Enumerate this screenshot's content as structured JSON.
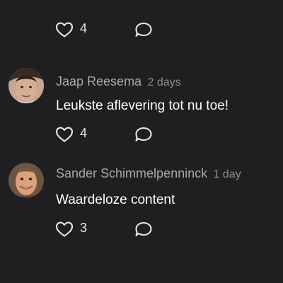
{
  "top_actions": {
    "like_count": "4"
  },
  "comments": [
    {
      "author": "Jaap Reesema",
      "time": "2 days",
      "text": "Leukste aflevering tot nu toe!",
      "like_count": "4"
    },
    {
      "author": "Sander Schimmelpenninck",
      "time": "1 day",
      "text": "Waardeloze content",
      "like_count": "3"
    }
  ],
  "icons": {
    "like": "heart-outline-icon",
    "reply": "speech-bubble-icon"
  },
  "colors": {
    "background": "#1f1f21",
    "author": "#a9a9ad",
    "text": "#ffffff"
  }
}
